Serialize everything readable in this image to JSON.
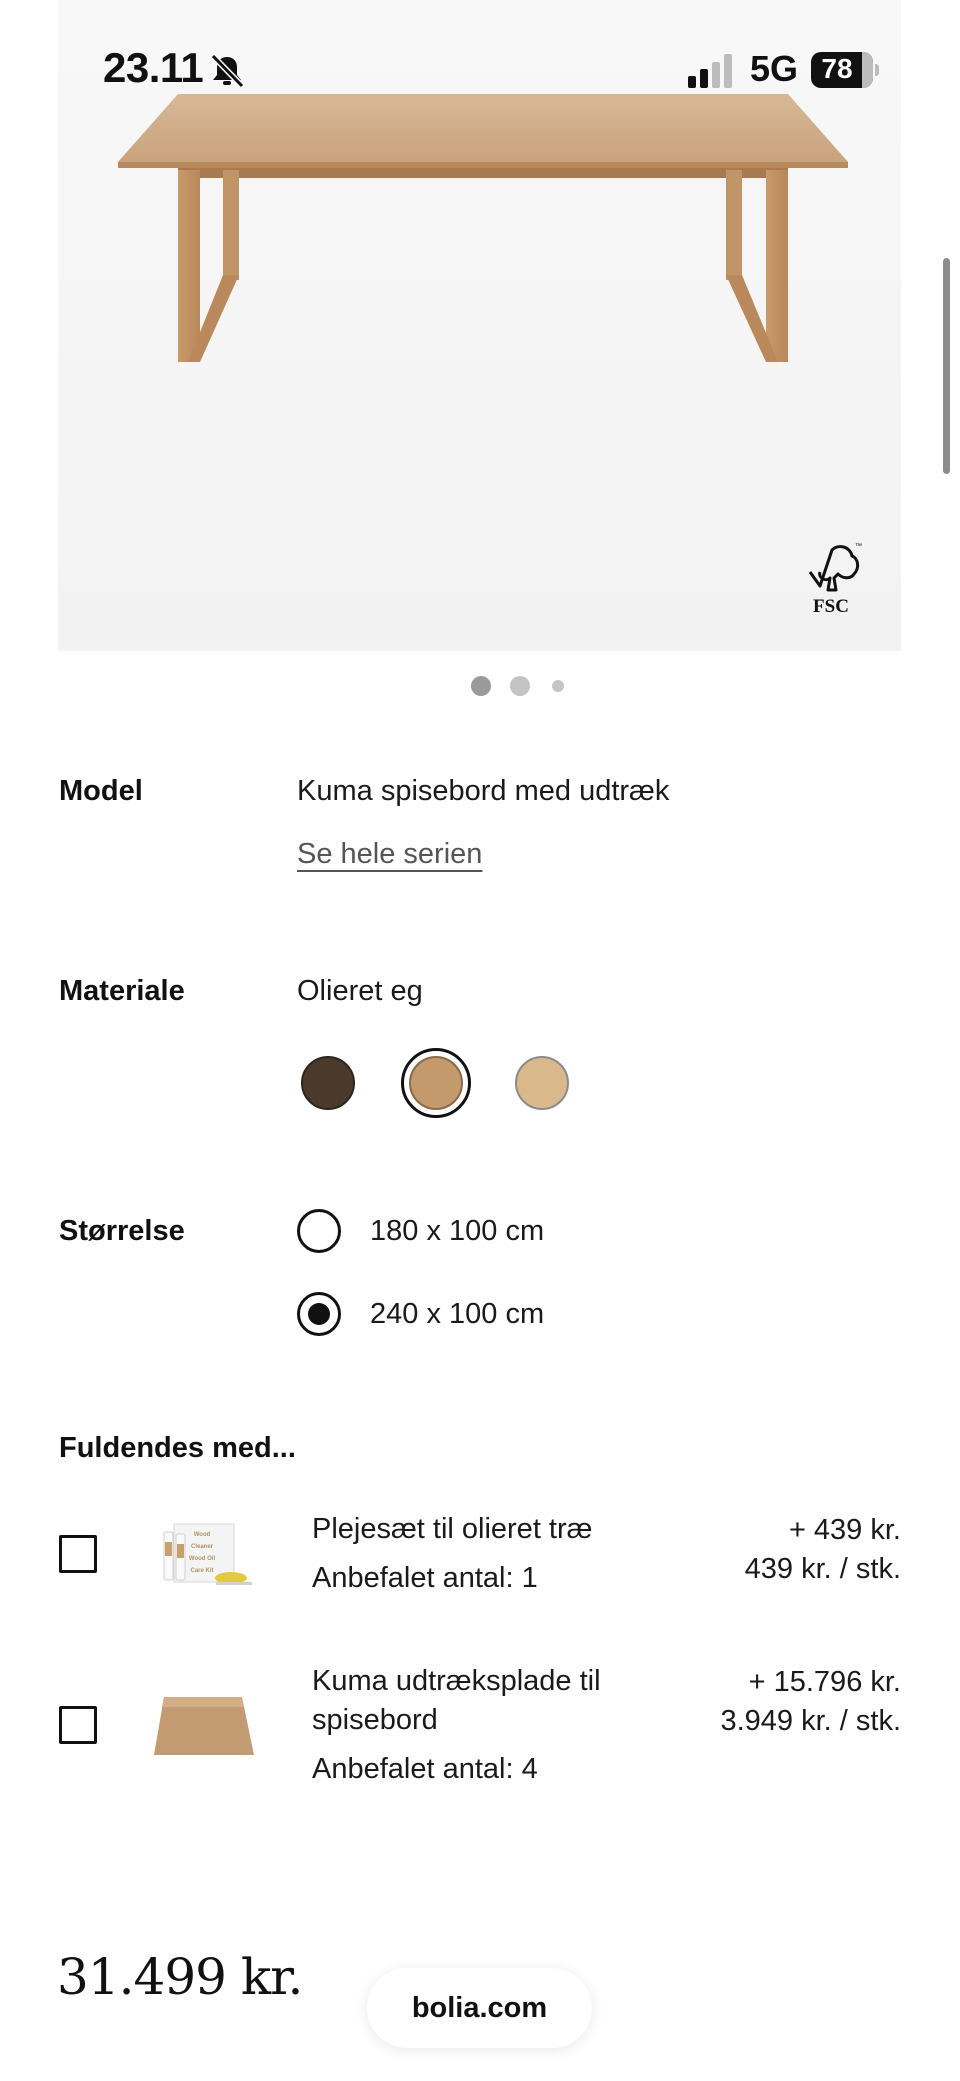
{
  "status_bar": {
    "time": "23.11",
    "network": "5G",
    "battery": "78",
    "icons": [
      "bell-slash-icon",
      "signal-icon",
      "battery-icon"
    ]
  },
  "hero": {
    "image_alt": "Kuma dining table in oiled oak",
    "badge": "FSC",
    "carousel_page": 1,
    "carousel_count": 3
  },
  "model": {
    "label": "Model",
    "value": "Kuma spisebord med udtræk",
    "series_link": "Se hele serien"
  },
  "material": {
    "label": "Materiale",
    "value": "Olieret eg",
    "selected_index": 1,
    "swatches": [
      {
        "name": "dark-oak",
        "color": "#4b3a2c"
      },
      {
        "name": "oiled-oak",
        "color": "#c49a6c"
      },
      {
        "name": "light-oak",
        "color": "#d9b98c"
      }
    ]
  },
  "size": {
    "label": "Størrelse",
    "selected_index": 1,
    "options": [
      {
        "label": "180 x 100 cm"
      },
      {
        "label": "240 x 100 cm"
      }
    ]
  },
  "complete_with": {
    "title": "Fuldendes med...",
    "items": [
      {
        "name": "Plejesæt til olieret træ",
        "qty": "Anbefalet antal: 1",
        "price_total": "+ 439 kr.",
        "price_unit": "439 kr. / stk.",
        "checked": false,
        "thumb_lines": [
          "Wood",
          "Cleaner",
          "Wood Oil",
          "Care Kit"
        ]
      },
      {
        "name": "Kuma udtræksplade til spisebord",
        "qty": "Anbefalet antal: 4",
        "price_total": "+ 15.796 kr.",
        "price_unit": "3.949 kr. / stk.",
        "checked": false
      }
    ]
  },
  "total": {
    "price": "31.499 kr."
  },
  "browser": {
    "url": "bolia.com"
  },
  "colors": {
    "text": "#111111",
    "oak": "#c49a6c",
    "hero_bg": "#f4f4f4"
  }
}
